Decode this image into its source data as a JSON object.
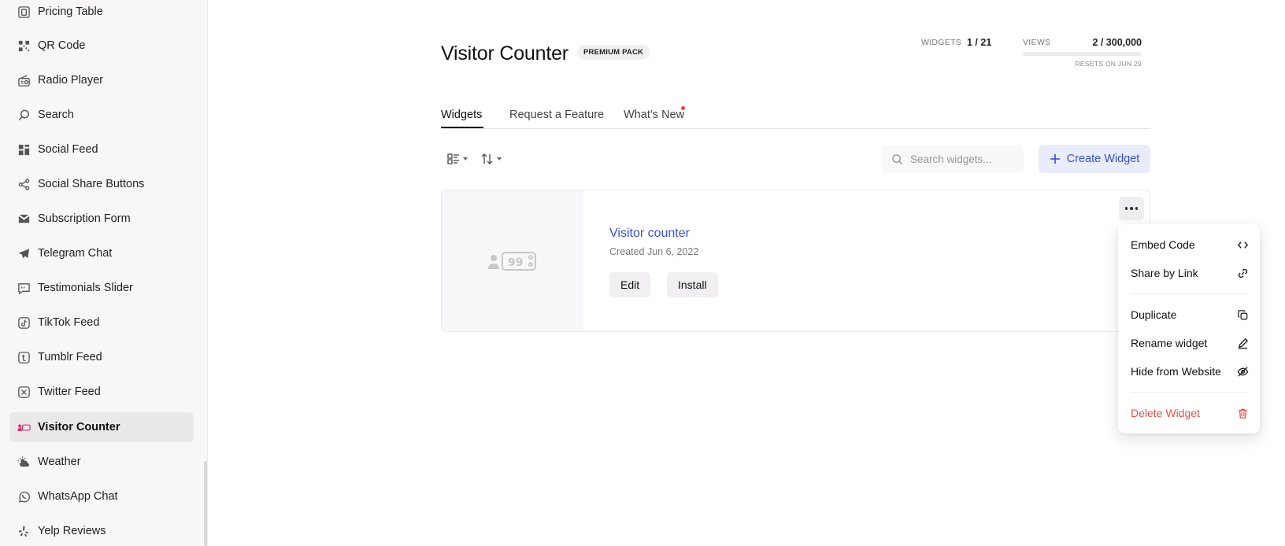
{
  "sidebar": {
    "items": [
      {
        "label": "Pricing Table",
        "icon": "pricing-table-icon"
      },
      {
        "label": "QR Code",
        "icon": "qr-code-icon"
      },
      {
        "label": "Radio Player",
        "icon": "radio-icon"
      },
      {
        "label": "Search",
        "icon": "search-icon"
      },
      {
        "label": "Social Feed",
        "icon": "social-feed-icon"
      },
      {
        "label": "Social Share Buttons",
        "icon": "share-icon"
      },
      {
        "label": "Subscription Form",
        "icon": "mail-icon"
      },
      {
        "label": "Telegram Chat",
        "icon": "telegram-icon"
      },
      {
        "label": "Testimonials Slider",
        "icon": "testimonial-icon"
      },
      {
        "label": "TikTok Feed",
        "icon": "tiktok-icon"
      },
      {
        "label": "Tumblr Feed",
        "icon": "tumblr-icon"
      },
      {
        "label": "Twitter Feed",
        "icon": "twitter-icon"
      },
      {
        "label": "Visitor Counter",
        "icon": "visitor-counter-icon",
        "active": true
      },
      {
        "label": "Weather",
        "icon": "weather-icon"
      },
      {
        "label": "WhatsApp Chat",
        "icon": "whatsapp-icon"
      },
      {
        "label": "Yelp Reviews",
        "icon": "yelp-icon"
      }
    ]
  },
  "header": {
    "title": "Visitor Counter",
    "badge": "PREMIUM PACK",
    "widgets_label": "WIDGETS",
    "widgets_value": "1 / 21",
    "views_label": "VIEWS",
    "views_value": "2 / 300,000",
    "views_progress_fraction": 1e-05,
    "resets": "RESETS ON JUN 29"
  },
  "tabs": [
    {
      "label": "Widgets",
      "active": true
    },
    {
      "label": "Request a Feature"
    },
    {
      "label": "What’s New",
      "has_dot": true
    }
  ],
  "toolbar": {
    "search_placeholder": "Search widgets...",
    "create_label": "Create Widget"
  },
  "widget": {
    "title": "Visitor counter",
    "created": "Created Jun 6, 2022",
    "edit_label": "Edit",
    "install_label": "Install"
  },
  "menu": {
    "items": [
      {
        "label": "Embed Code",
        "icon": "code-icon"
      },
      {
        "label": "Share by Link",
        "icon": "link-icon"
      },
      {
        "label": "Duplicate",
        "icon": "duplicate-icon"
      },
      {
        "label": "Rename widget",
        "icon": "pencil-icon"
      },
      {
        "label": "Hide from Website",
        "icon": "eye-off-icon"
      },
      {
        "label": "Delete Widget",
        "icon": "trash-icon",
        "danger": true
      }
    ]
  },
  "colors": {
    "accent": "#3651d6",
    "danger": "#e5534b",
    "active_nav_bg": "#ebe8ec"
  }
}
